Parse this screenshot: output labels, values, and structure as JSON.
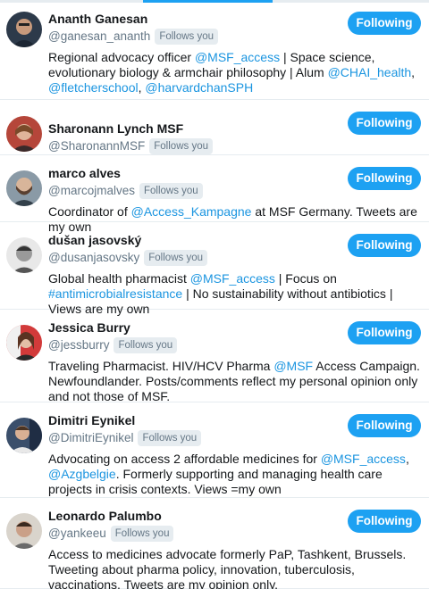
{
  "colors": {
    "accent": "#1da1f2",
    "link": "#1b95e0",
    "text": "#14171a",
    "muted": "#657786",
    "badge_bg": "#e6ecf0"
  },
  "following_label": "Following",
  "follows_you_label": "Follows you",
  "users": [
    {
      "name": "Ananth Ganesan",
      "handle": "@ganesan_ananth",
      "bio": [
        {
          "t": "Regional advocacy officer "
        },
        {
          "t": "@MSF_access",
          "link": true
        },
        {
          "t": " | Space science, evolutionary biology & armchair philosophy | Alum "
        },
        {
          "t": "@CHAI_health",
          "link": true
        },
        {
          "t": ", "
        },
        {
          "t": "@fletcherschool",
          "link": true
        },
        {
          "t": ", "
        },
        {
          "t": "@harvardchanSPH",
          "link": true
        }
      ]
    },
    {
      "name": "Sharonann Lynch MSF",
      "handle": "@SharonannMSF",
      "bio": []
    },
    {
      "name": "marco alves",
      "handle": "@marcojmalves",
      "bio": [
        {
          "t": "Coordinator of "
        },
        {
          "t": "@Access_Kampagne",
          "link": true
        },
        {
          "t": " at MSF Germany. Tweets are my own"
        }
      ]
    },
    {
      "name": "dušan jasovský",
      "handle": "@dusanjasovsky",
      "bio": [
        {
          "t": "Global health pharmacist "
        },
        {
          "t": "@MSF_access",
          "link": true
        },
        {
          "t": " | Focus on "
        },
        {
          "t": "#antimicrobialresistance",
          "link": true
        },
        {
          "t": " | No sustainability without antibiotics | Views are my own"
        }
      ]
    },
    {
      "name": "Jessica Burry",
      "handle": "@jessburry",
      "bio": [
        {
          "t": "Traveling Pharmacist. HIV/HCV Pharma "
        },
        {
          "t": "@MSF",
          "link": true
        },
        {
          "t": " Access Campaign. Newfoundlander. Posts/comments reflect my personal opinion only and not those of MSF."
        }
      ]
    },
    {
      "name": "Dimitri Eynikel",
      "handle": "@DimitriEynikel",
      "bio": [
        {
          "t": "Advocating on access 2 affordable medicines for "
        },
        {
          "t": "@MSF_access",
          "link": true
        },
        {
          "t": ", "
        },
        {
          "t": "@Azgbelgie",
          "link": true
        },
        {
          "t": ". Formerly supporting and managing health care projects in crisis contexts. Views =my own"
        }
      ]
    },
    {
      "name": "Leonardo Palumbo",
      "handle": "@yankeeu",
      "bio": [
        {
          "t": "Access to medicines advocate formerly PaP, Tashkent, Brussels. Tweeting about pharma policy, innovation, tuberculosis, vaccinations. Tweets are my opinion only."
        }
      ]
    }
  ]
}
